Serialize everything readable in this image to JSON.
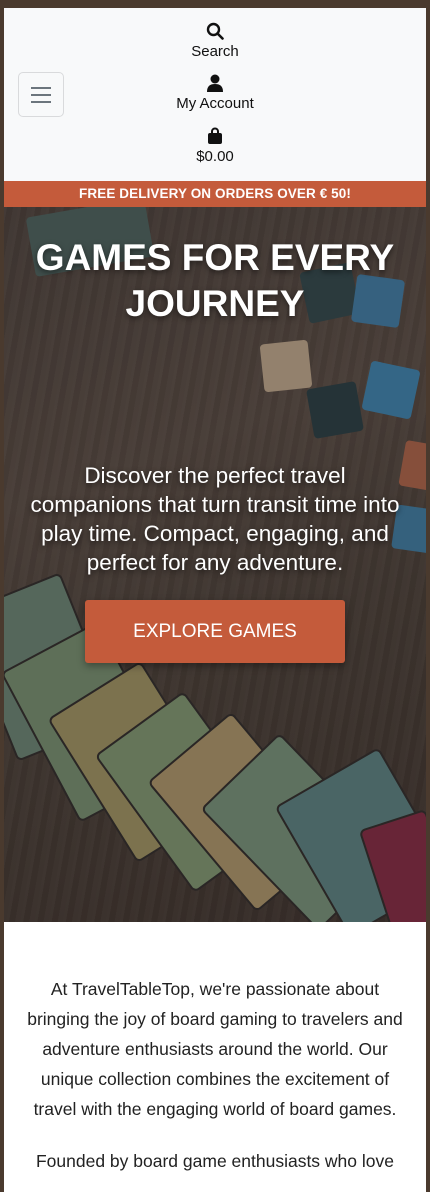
{
  "nav": {
    "search_label": "Search",
    "account_label": "My Account",
    "cart_total": "$0.00"
  },
  "banner": {
    "text": "FREE DELIVERY ON ORDERS OVER € 50!"
  },
  "hero": {
    "title": "GAMES FOR EVERY JOURNEY",
    "subtitle": "Discover the perfect travel companions that turn transit time into play time. Compact, engaging, and perfect for any adventure.",
    "button_label": "EXPLORE GAMES"
  },
  "about": {
    "paragraph_1": "At TravelTableTop, we're passionate about bringing the joy of board gaming to travelers and adventure enthusiasts around the world. Our unique collection combines the excitement of travel with the engaging world of board games.",
    "paragraph_2": "Founded by board game enthusiasts who love"
  },
  "colors": {
    "accent": "#c45b3b",
    "navbar_bg": "#f8f9fa",
    "page_bg": "#ffffff"
  },
  "icons": [
    "menu-icon",
    "search-icon",
    "user-icon",
    "shopping-bag-icon"
  ]
}
